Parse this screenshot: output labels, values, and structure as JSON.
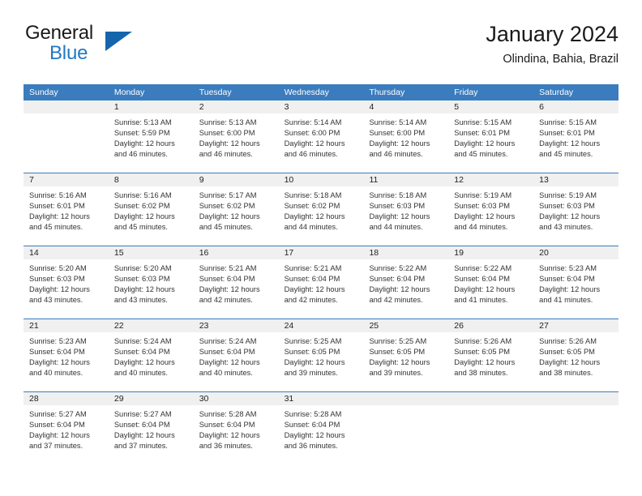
{
  "brand": {
    "name_part1": "General",
    "name_part2": "Blue",
    "triangle_color": "#1565ad",
    "blue_color": "#2079c4"
  },
  "header": {
    "title": "January 2024",
    "location": "Olindina, Bahia, Brazil"
  },
  "theme": {
    "header_row_bg": "#3a7cbe",
    "day_number_bg": "#f0f0f0",
    "text_color": "#333333"
  },
  "calendar": {
    "weekday_headers": [
      "Sunday",
      "Monday",
      "Tuesday",
      "Wednesday",
      "Thursday",
      "Friday",
      "Saturday"
    ],
    "weeks": [
      [
        {
          "day": "",
          "lines": []
        },
        {
          "day": "1",
          "lines": [
            "Sunrise: 5:13 AM",
            "Sunset: 5:59 PM",
            "Daylight: 12 hours",
            "and 46 minutes."
          ]
        },
        {
          "day": "2",
          "lines": [
            "Sunrise: 5:13 AM",
            "Sunset: 6:00 PM",
            "Daylight: 12 hours",
            "and 46 minutes."
          ]
        },
        {
          "day": "3",
          "lines": [
            "Sunrise: 5:14 AM",
            "Sunset: 6:00 PM",
            "Daylight: 12 hours",
            "and 46 minutes."
          ]
        },
        {
          "day": "4",
          "lines": [
            "Sunrise: 5:14 AM",
            "Sunset: 6:00 PM",
            "Daylight: 12 hours",
            "and 46 minutes."
          ]
        },
        {
          "day": "5",
          "lines": [
            "Sunrise: 5:15 AM",
            "Sunset: 6:01 PM",
            "Daylight: 12 hours",
            "and 45 minutes."
          ]
        },
        {
          "day": "6",
          "lines": [
            "Sunrise: 5:15 AM",
            "Sunset: 6:01 PM",
            "Daylight: 12 hours",
            "and 45 minutes."
          ]
        }
      ],
      [
        {
          "day": "7",
          "lines": [
            "Sunrise: 5:16 AM",
            "Sunset: 6:01 PM",
            "Daylight: 12 hours",
            "and 45 minutes."
          ]
        },
        {
          "day": "8",
          "lines": [
            "Sunrise: 5:16 AM",
            "Sunset: 6:02 PM",
            "Daylight: 12 hours",
            "and 45 minutes."
          ]
        },
        {
          "day": "9",
          "lines": [
            "Sunrise: 5:17 AM",
            "Sunset: 6:02 PM",
            "Daylight: 12 hours",
            "and 45 minutes."
          ]
        },
        {
          "day": "10",
          "lines": [
            "Sunrise: 5:18 AM",
            "Sunset: 6:02 PM",
            "Daylight: 12 hours",
            "and 44 minutes."
          ]
        },
        {
          "day": "11",
          "lines": [
            "Sunrise: 5:18 AM",
            "Sunset: 6:03 PM",
            "Daylight: 12 hours",
            "and 44 minutes."
          ]
        },
        {
          "day": "12",
          "lines": [
            "Sunrise: 5:19 AM",
            "Sunset: 6:03 PM",
            "Daylight: 12 hours",
            "and 44 minutes."
          ]
        },
        {
          "day": "13",
          "lines": [
            "Sunrise: 5:19 AM",
            "Sunset: 6:03 PM",
            "Daylight: 12 hours",
            "and 43 minutes."
          ]
        }
      ],
      [
        {
          "day": "14",
          "lines": [
            "Sunrise: 5:20 AM",
            "Sunset: 6:03 PM",
            "Daylight: 12 hours",
            "and 43 minutes."
          ]
        },
        {
          "day": "15",
          "lines": [
            "Sunrise: 5:20 AM",
            "Sunset: 6:03 PM",
            "Daylight: 12 hours",
            "and 43 minutes."
          ]
        },
        {
          "day": "16",
          "lines": [
            "Sunrise: 5:21 AM",
            "Sunset: 6:04 PM",
            "Daylight: 12 hours",
            "and 42 minutes."
          ]
        },
        {
          "day": "17",
          "lines": [
            "Sunrise: 5:21 AM",
            "Sunset: 6:04 PM",
            "Daylight: 12 hours",
            "and 42 minutes."
          ]
        },
        {
          "day": "18",
          "lines": [
            "Sunrise: 5:22 AM",
            "Sunset: 6:04 PM",
            "Daylight: 12 hours",
            "and 42 minutes."
          ]
        },
        {
          "day": "19",
          "lines": [
            "Sunrise: 5:22 AM",
            "Sunset: 6:04 PM",
            "Daylight: 12 hours",
            "and 41 minutes."
          ]
        },
        {
          "day": "20",
          "lines": [
            "Sunrise: 5:23 AM",
            "Sunset: 6:04 PM",
            "Daylight: 12 hours",
            "and 41 minutes."
          ]
        }
      ],
      [
        {
          "day": "21",
          "lines": [
            "Sunrise: 5:23 AM",
            "Sunset: 6:04 PM",
            "Daylight: 12 hours",
            "and 40 minutes."
          ]
        },
        {
          "day": "22",
          "lines": [
            "Sunrise: 5:24 AM",
            "Sunset: 6:04 PM",
            "Daylight: 12 hours",
            "and 40 minutes."
          ]
        },
        {
          "day": "23",
          "lines": [
            "Sunrise: 5:24 AM",
            "Sunset: 6:04 PM",
            "Daylight: 12 hours",
            "and 40 minutes."
          ]
        },
        {
          "day": "24",
          "lines": [
            "Sunrise: 5:25 AM",
            "Sunset: 6:05 PM",
            "Daylight: 12 hours",
            "and 39 minutes."
          ]
        },
        {
          "day": "25",
          "lines": [
            "Sunrise: 5:25 AM",
            "Sunset: 6:05 PM",
            "Daylight: 12 hours",
            "and 39 minutes."
          ]
        },
        {
          "day": "26",
          "lines": [
            "Sunrise: 5:26 AM",
            "Sunset: 6:05 PM",
            "Daylight: 12 hours",
            "and 38 minutes."
          ]
        },
        {
          "day": "27",
          "lines": [
            "Sunrise: 5:26 AM",
            "Sunset: 6:05 PM",
            "Daylight: 12 hours",
            "and 38 minutes."
          ]
        }
      ],
      [
        {
          "day": "28",
          "lines": [
            "Sunrise: 5:27 AM",
            "Sunset: 6:04 PM",
            "Daylight: 12 hours",
            "and 37 minutes."
          ]
        },
        {
          "day": "29",
          "lines": [
            "Sunrise: 5:27 AM",
            "Sunset: 6:04 PM",
            "Daylight: 12 hours",
            "and 37 minutes."
          ]
        },
        {
          "day": "30",
          "lines": [
            "Sunrise: 5:28 AM",
            "Sunset: 6:04 PM",
            "Daylight: 12 hours",
            "and 36 minutes."
          ]
        },
        {
          "day": "31",
          "lines": [
            "Sunrise: 5:28 AM",
            "Sunset: 6:04 PM",
            "Daylight: 12 hours",
            "and 36 minutes."
          ]
        },
        {
          "day": "",
          "lines": []
        },
        {
          "day": "",
          "lines": []
        },
        {
          "day": "",
          "lines": []
        }
      ]
    ]
  }
}
